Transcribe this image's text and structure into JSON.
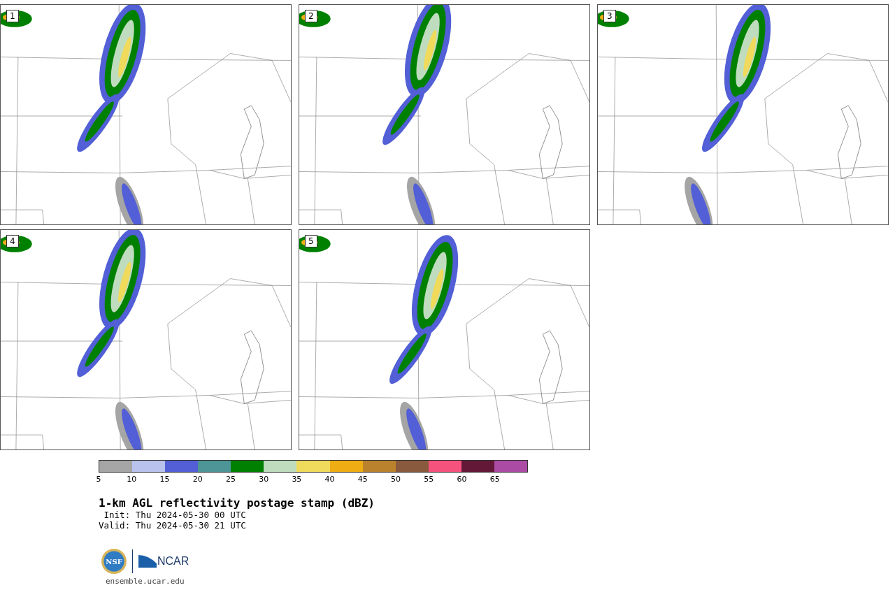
{
  "panels": [
    {
      "label": "1"
    },
    {
      "label": "2"
    },
    {
      "label": "3"
    },
    {
      "label": "4"
    },
    {
      "label": "5"
    }
  ],
  "colorbar": {
    "bins": [
      {
        "color": "#a5a5a5"
      },
      {
        "color": "#b8c2ec"
      },
      {
        "color": "#525fd6"
      },
      {
        "color": "#4e9597"
      },
      {
        "color": "#008000"
      },
      {
        "color": "#bfdcbf"
      },
      {
        "color": "#f0da5c"
      },
      {
        "color": "#efad14"
      },
      {
        "color": "#bb822e"
      },
      {
        "color": "#8a5a3f"
      },
      {
        "color": "#f6527e"
      },
      {
        "color": "#641838"
      },
      {
        "color": "#ab4ba4"
      }
    ],
    "ticks": [
      "5",
      "10",
      "15",
      "20",
      "25",
      "30",
      "35",
      "40",
      "45",
      "50",
      "55",
      "60",
      "65"
    ]
  },
  "title": "1-km AGL reflectivity postage stamp (dBZ)",
  "init": " Init: Thu 2024-05-30 00 UTC",
  "valid": "Valid: Thu 2024-05-30 21 UTC",
  "logos": {
    "nsf": "NSF",
    "ncar": "NCAR"
  },
  "footer": "ensemble.ucar.edu"
}
